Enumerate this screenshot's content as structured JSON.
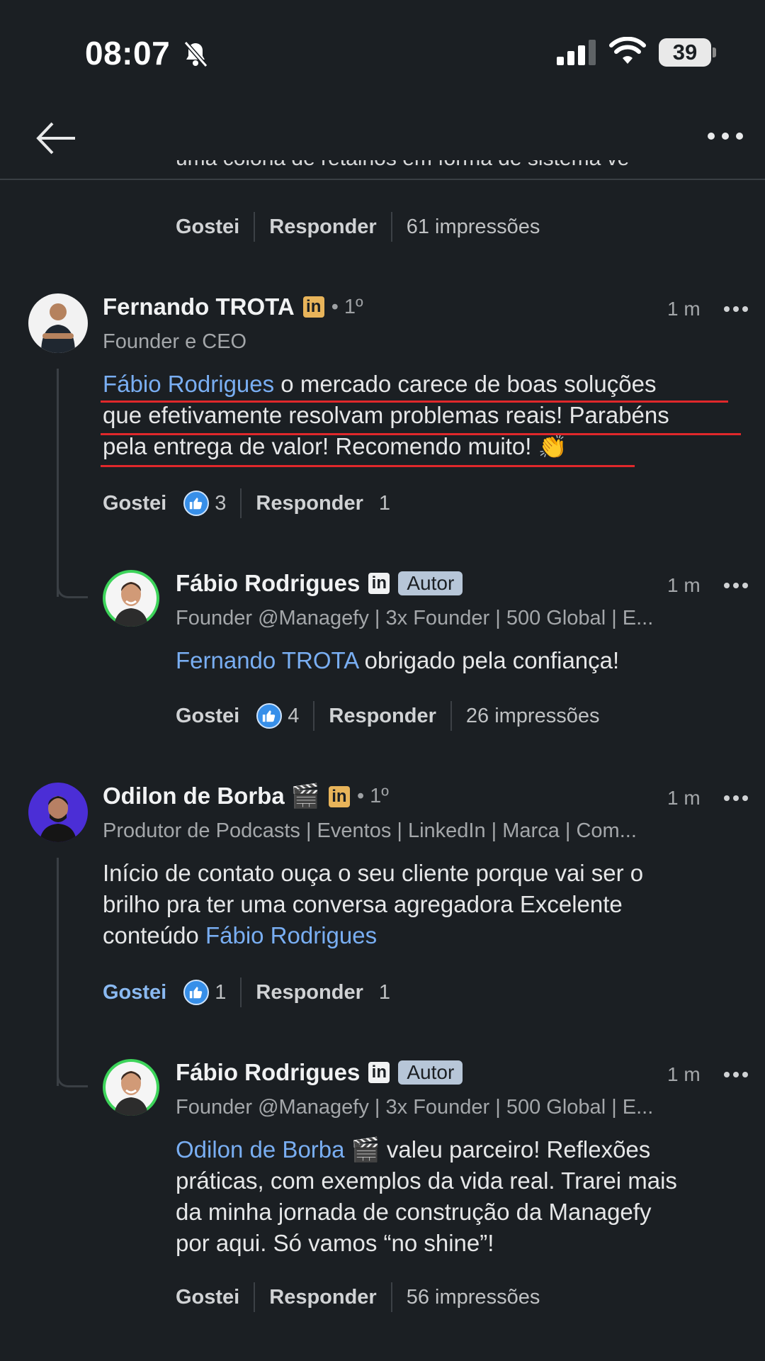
{
  "status": {
    "time": "08:07",
    "battery": "39"
  },
  "top_comment": {
    "cut_text": "uma colona de retalhos em forma de sistema ve",
    "like": "Gostei",
    "reply": "Responder",
    "impressions": "61 impressões"
  },
  "comments": [
    {
      "author": "Fernando TROTA",
      "degree": "• 1º",
      "headline": "Founder e CEO",
      "time": "1 m",
      "mention": "Fábio Rodrigues",
      "line1": " o mercado carece de boas soluções",
      "line2": "que efetivamente resolvam problemas reais! Parabéns",
      "line3": "pela entrega de valor! Recomendo muito! 👏",
      "like": "Gostei",
      "reactions": "3",
      "reply": "Responder",
      "replies": "1",
      "reply_comment": {
        "author": "Fábio Rodrigues",
        "badge": "Autor",
        "headline": "Founder @Managefy | 3x Founder | 500 Global | E...",
        "time": "1 m",
        "mention": "Fernando TROTA",
        "text": " obrigado pela confiança!",
        "like": "Gostei",
        "reactions": "4",
        "reply": "Responder",
        "impressions": "26 impressões"
      }
    },
    {
      "author": "Odilon de Borba 🎬",
      "degree": "• 1º",
      "headline": "Produtor de Podcasts | Eventos | LinkedIn | Marca | Com...",
      "time": "1 m",
      "line1": "Início de contato ouça o seu cliente porque vai ser o",
      "line2": "brilho pra ter uma conversa agregadora Excelente",
      "line3_prefix": "conteúdo ",
      "mention": "Fábio Rodrigues",
      "like": "Gostei",
      "reactions": "1",
      "reply": "Responder",
      "replies": "1",
      "reply_comment": {
        "author": "Fábio Rodrigues",
        "badge": "Autor",
        "headline": "Founder @Managefy | 3x Founder | 500 Global | E...",
        "time": "1 m",
        "mention": "Odilon de Borba 🎬",
        "line1": " valeu parceiro! Reflexões",
        "line2": "práticas, com exemplos da vida real. Trarei mais",
        "line3": "da minha jornada de construção da Managefy",
        "line4": "por aqui. Só vamos “no shine”!",
        "like": "Gostei",
        "reply": "Responder",
        "impressions": "56 impressões"
      }
    }
  ],
  "colors": {
    "background": "#1b1f23",
    "mention": "#79aef2",
    "accent_blue": "#378fe9",
    "underline_red": "#e0282b"
  },
  "icons": [
    "back-arrow-icon",
    "more-icon",
    "linkedin-icon",
    "like-reaction-icon",
    "bell-off-icon",
    "signal-icon",
    "wifi-icon",
    "battery-icon"
  ]
}
